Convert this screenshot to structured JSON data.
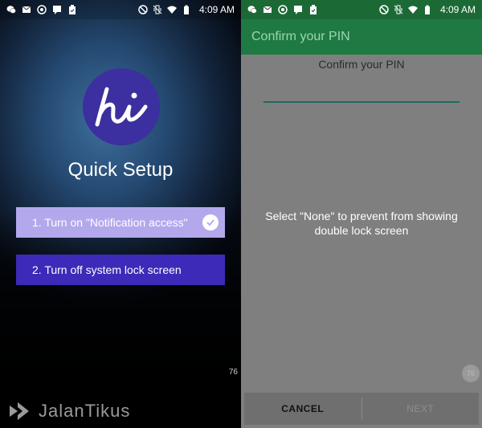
{
  "status_bar": {
    "time": "4:09 AM",
    "icons_left": [
      "wechat-icon",
      "mail-icon",
      "target-icon",
      "message-icon",
      "clipboard-icon"
    ],
    "icons_right": [
      "blocked-icon",
      "vibrate-icon",
      "wifi-icon",
      "battery-icon"
    ]
  },
  "left": {
    "logo_text": "hi",
    "title": "Quick Setup",
    "step1_label": "1. Turn on \"Notification access\"",
    "step1_done": true,
    "step2_label": "2. Turn off system lock screen",
    "badge": "76",
    "watermark": "JalanTikus"
  },
  "right": {
    "appbar_title": "Confirm your PIN",
    "pin_label": "Confirm your PIN",
    "pin_value": "",
    "notice": "Select \"None\" to prevent from showing double lock screen",
    "badge": "76",
    "cancel_label": "CANCEL",
    "next_label": "NEXT"
  },
  "colors": {
    "logo_bg": "#3c2fa0",
    "step1_bg": "#b4a8ec",
    "step2_bg": "#3d2ab8",
    "appbar_bg": "#1e7a42"
  }
}
